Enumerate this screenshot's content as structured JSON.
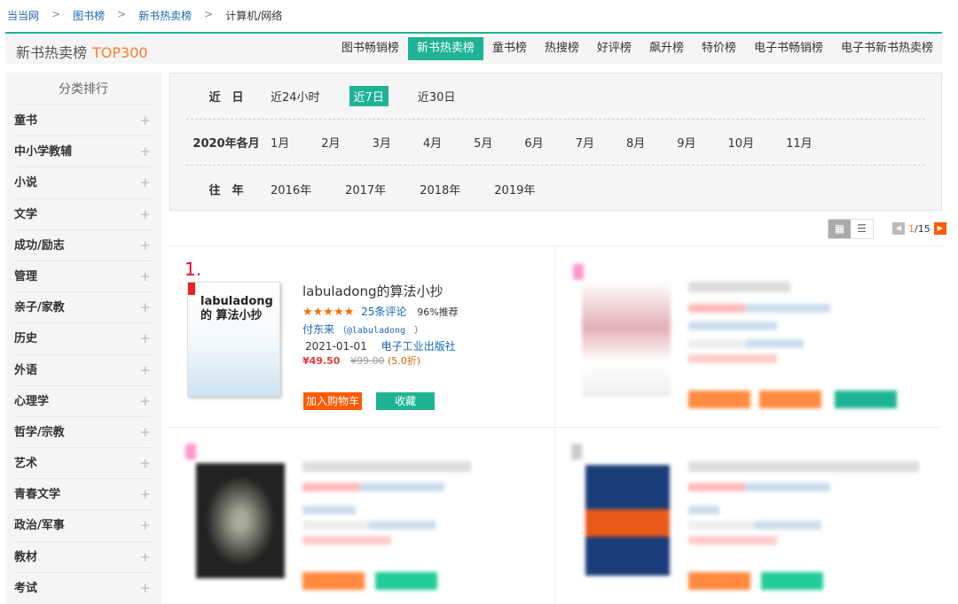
{
  "breadcrumb": [
    "当当网",
    "图书榜",
    "新书热卖榜",
    "计算机/网络"
  ],
  "breadcrumb_sep": ">",
  "header": {
    "title": "新书热卖榜",
    "suffix": "TOP300"
  },
  "tabs": [
    {
      "label": "图书畅销榜"
    },
    {
      "label": "新书热卖榜",
      "active": true
    },
    {
      "label": "童书榜"
    },
    {
      "label": "热搜榜"
    },
    {
      "label": "好评榜"
    },
    {
      "label": "飙升榜"
    },
    {
      "label": "特价榜"
    },
    {
      "label": "电子书畅销榜"
    },
    {
      "label": "电子书新书热卖榜"
    }
  ],
  "sidebar": {
    "title": "分类排行",
    "items": [
      "童书",
      "中小学教辅",
      "小说",
      "文学",
      "成功/励志",
      "管理",
      "亲子/家教",
      "历史",
      "外语",
      "心理学",
      "哲学/宗教",
      "艺术",
      "青春文学",
      "政治/军事",
      "教材",
      "考试"
    ],
    "expand_glyph": "+"
  },
  "filters": {
    "recent": {
      "label": "近　日",
      "options": [
        "近24小时",
        "近7日",
        "近30日"
      ],
      "selected": "近7日"
    },
    "months": {
      "label": "2020年各月",
      "options": [
        "1月",
        "2月",
        "3月",
        "4月",
        "5月",
        "6月",
        "7月",
        "8月",
        "9月",
        "10月",
        "11月"
      ]
    },
    "years": {
      "label": "往　年",
      "options": [
        "2016年",
        "2017年",
        "2018年",
        "2019年"
      ]
    }
  },
  "pager": {
    "current": "1",
    "total": "/15"
  },
  "books": [
    {
      "rank": "1.",
      "title": "labuladong的算法小抄",
      "cover_text": "labuladong的 算法小抄",
      "rating": 5,
      "stars": "★★★★★",
      "reviews": "25条评论",
      "recommend": "96%推荐",
      "author": "付东来",
      "author_alias": "（@labuladong　）",
      "date": "2021-01-01",
      "publisher": "电子工业出版社",
      "price": "¥49.50",
      "orig_price": "¥99.00",
      "discount": "(5.0折)",
      "cart_label": "加入购物车",
      "fav_label": "收藏"
    }
  ],
  "colors": {
    "accent": "#1db394",
    "orange": "#ff7a2e",
    "cart": "#ff5a00"
  }
}
